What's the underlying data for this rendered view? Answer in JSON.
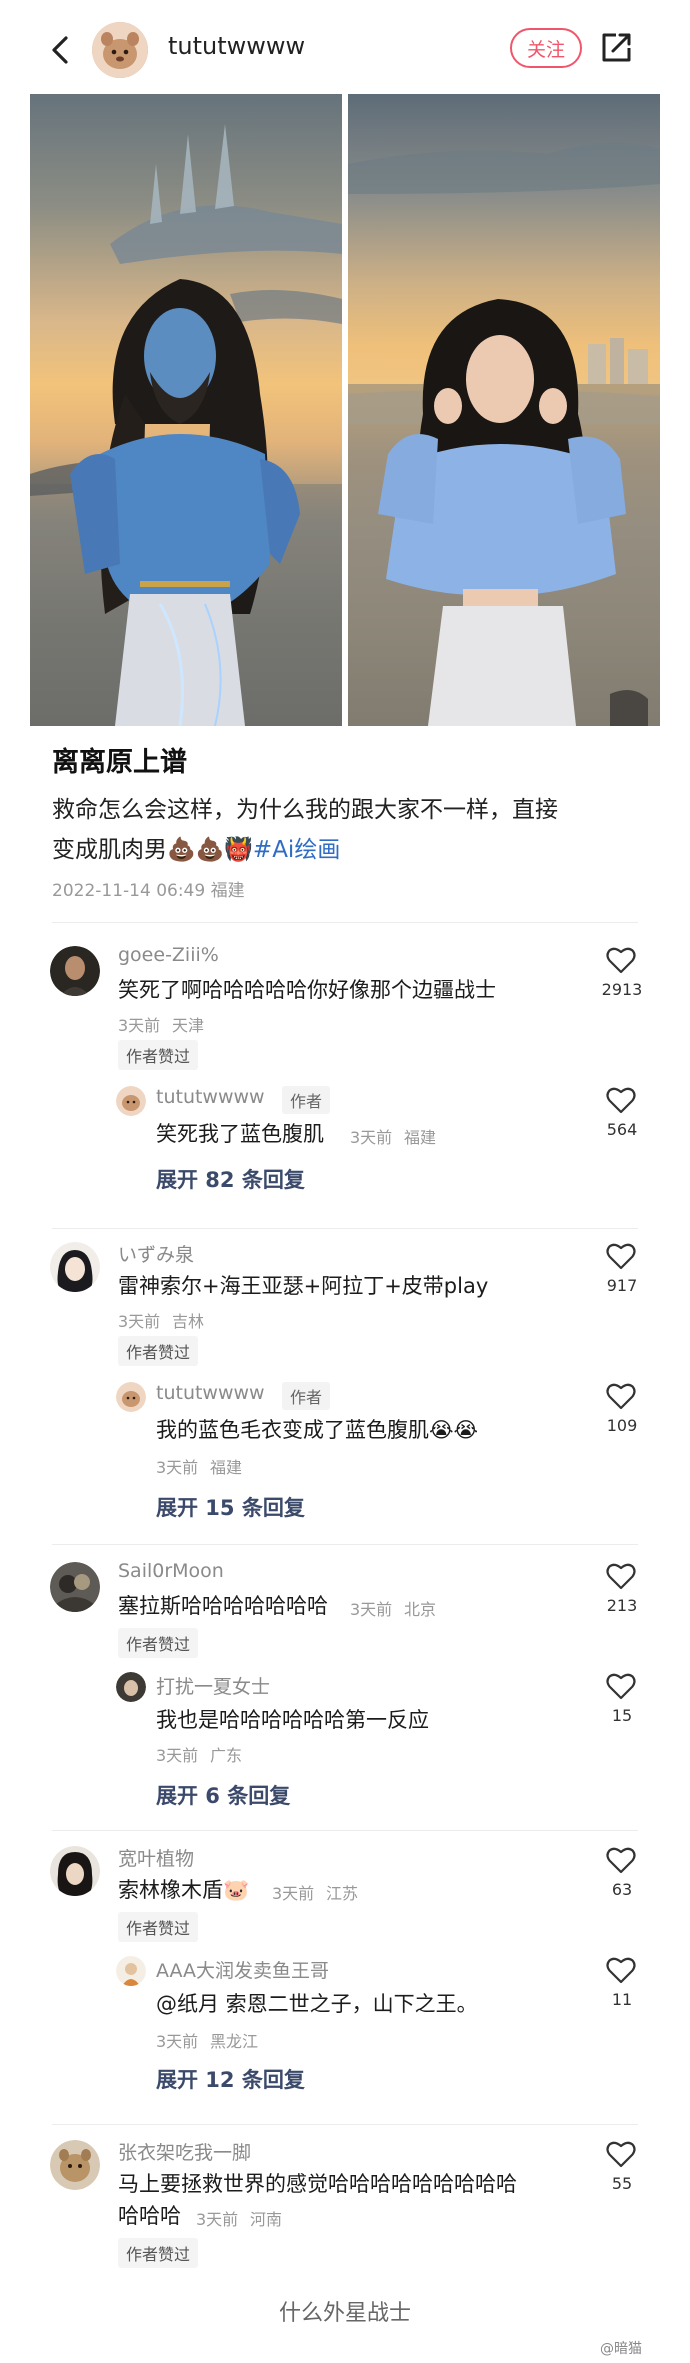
{
  "header": {
    "username": "tututwwww",
    "follow_label": "关注"
  },
  "post": {
    "title": "离离原上谱",
    "body_line1": "救命怎么会这样，为什么我的跟大家不一样，直接",
    "body_line2_prefix": "变成肌肉男💩💩👹",
    "hashtag": "#Ai绘画",
    "date": "2022-11-14 06:49",
    "location": "福建"
  },
  "comments": [
    {
      "name": "goee-Ziii%",
      "text": "笑死了啊哈哈哈哈哈你好像那个边疆战士",
      "time": "3天前",
      "location": "天津",
      "badge": "作者赞过",
      "likes": "2913",
      "reply": {
        "name": "tututwwww",
        "author_tag": "作者",
        "text": "笑死我了蓝色腹肌",
        "time": "3天前",
        "location": "福建",
        "likes": "564"
      },
      "expand": "展开 82 条回复"
    },
    {
      "name": "いずみ泉",
      "text": "雷神索尔+海王亚瑟+阿拉丁+皮带play",
      "time": "3天前",
      "location": "吉林",
      "badge": "作者赞过",
      "likes": "917",
      "reply": {
        "name": "tututwwww",
        "author_tag": "作者",
        "text": "我的蓝色毛衣变成了蓝色腹肌😭😭",
        "time": "3天前",
        "location": "福建",
        "likes": "109"
      },
      "expand": "展开 15 条回复"
    },
    {
      "name": "Sail0rMoon",
      "text": "塞拉斯哈哈哈哈哈哈哈",
      "time": "3天前",
      "location": "北京",
      "badge": "作者赞过",
      "likes": "213",
      "reply": {
        "name": "打扰一夏女士",
        "text": "我也是哈哈哈哈哈哈第一反应",
        "time": "3天前",
        "location": "广东",
        "likes": "15"
      },
      "expand": "展开 6 条回复"
    },
    {
      "name": "宽叶植物",
      "text": "索林橡木盾🐷",
      "time": "3天前",
      "location": "江苏",
      "badge": "作者赞过",
      "likes": "63",
      "reply": {
        "name": "AAA大润发卖鱼王哥",
        "text": "@纸月 索恩二世之子，山下之王。",
        "time": "3天前",
        "location": "黑龙江",
        "likes": "11"
      },
      "expand": "展开 12 条回复"
    },
    {
      "name": "张衣架吃我一脚",
      "text_line1": "马上要拯救世界的感觉哈哈哈哈哈哈哈哈哈",
      "text_line2": "哈哈哈",
      "time": "3天前",
      "location": "河南",
      "badge": "作者赞过",
      "likes": "55"
    }
  ],
  "footer_text": "什么外星战士",
  "watermark": "@暗猫"
}
